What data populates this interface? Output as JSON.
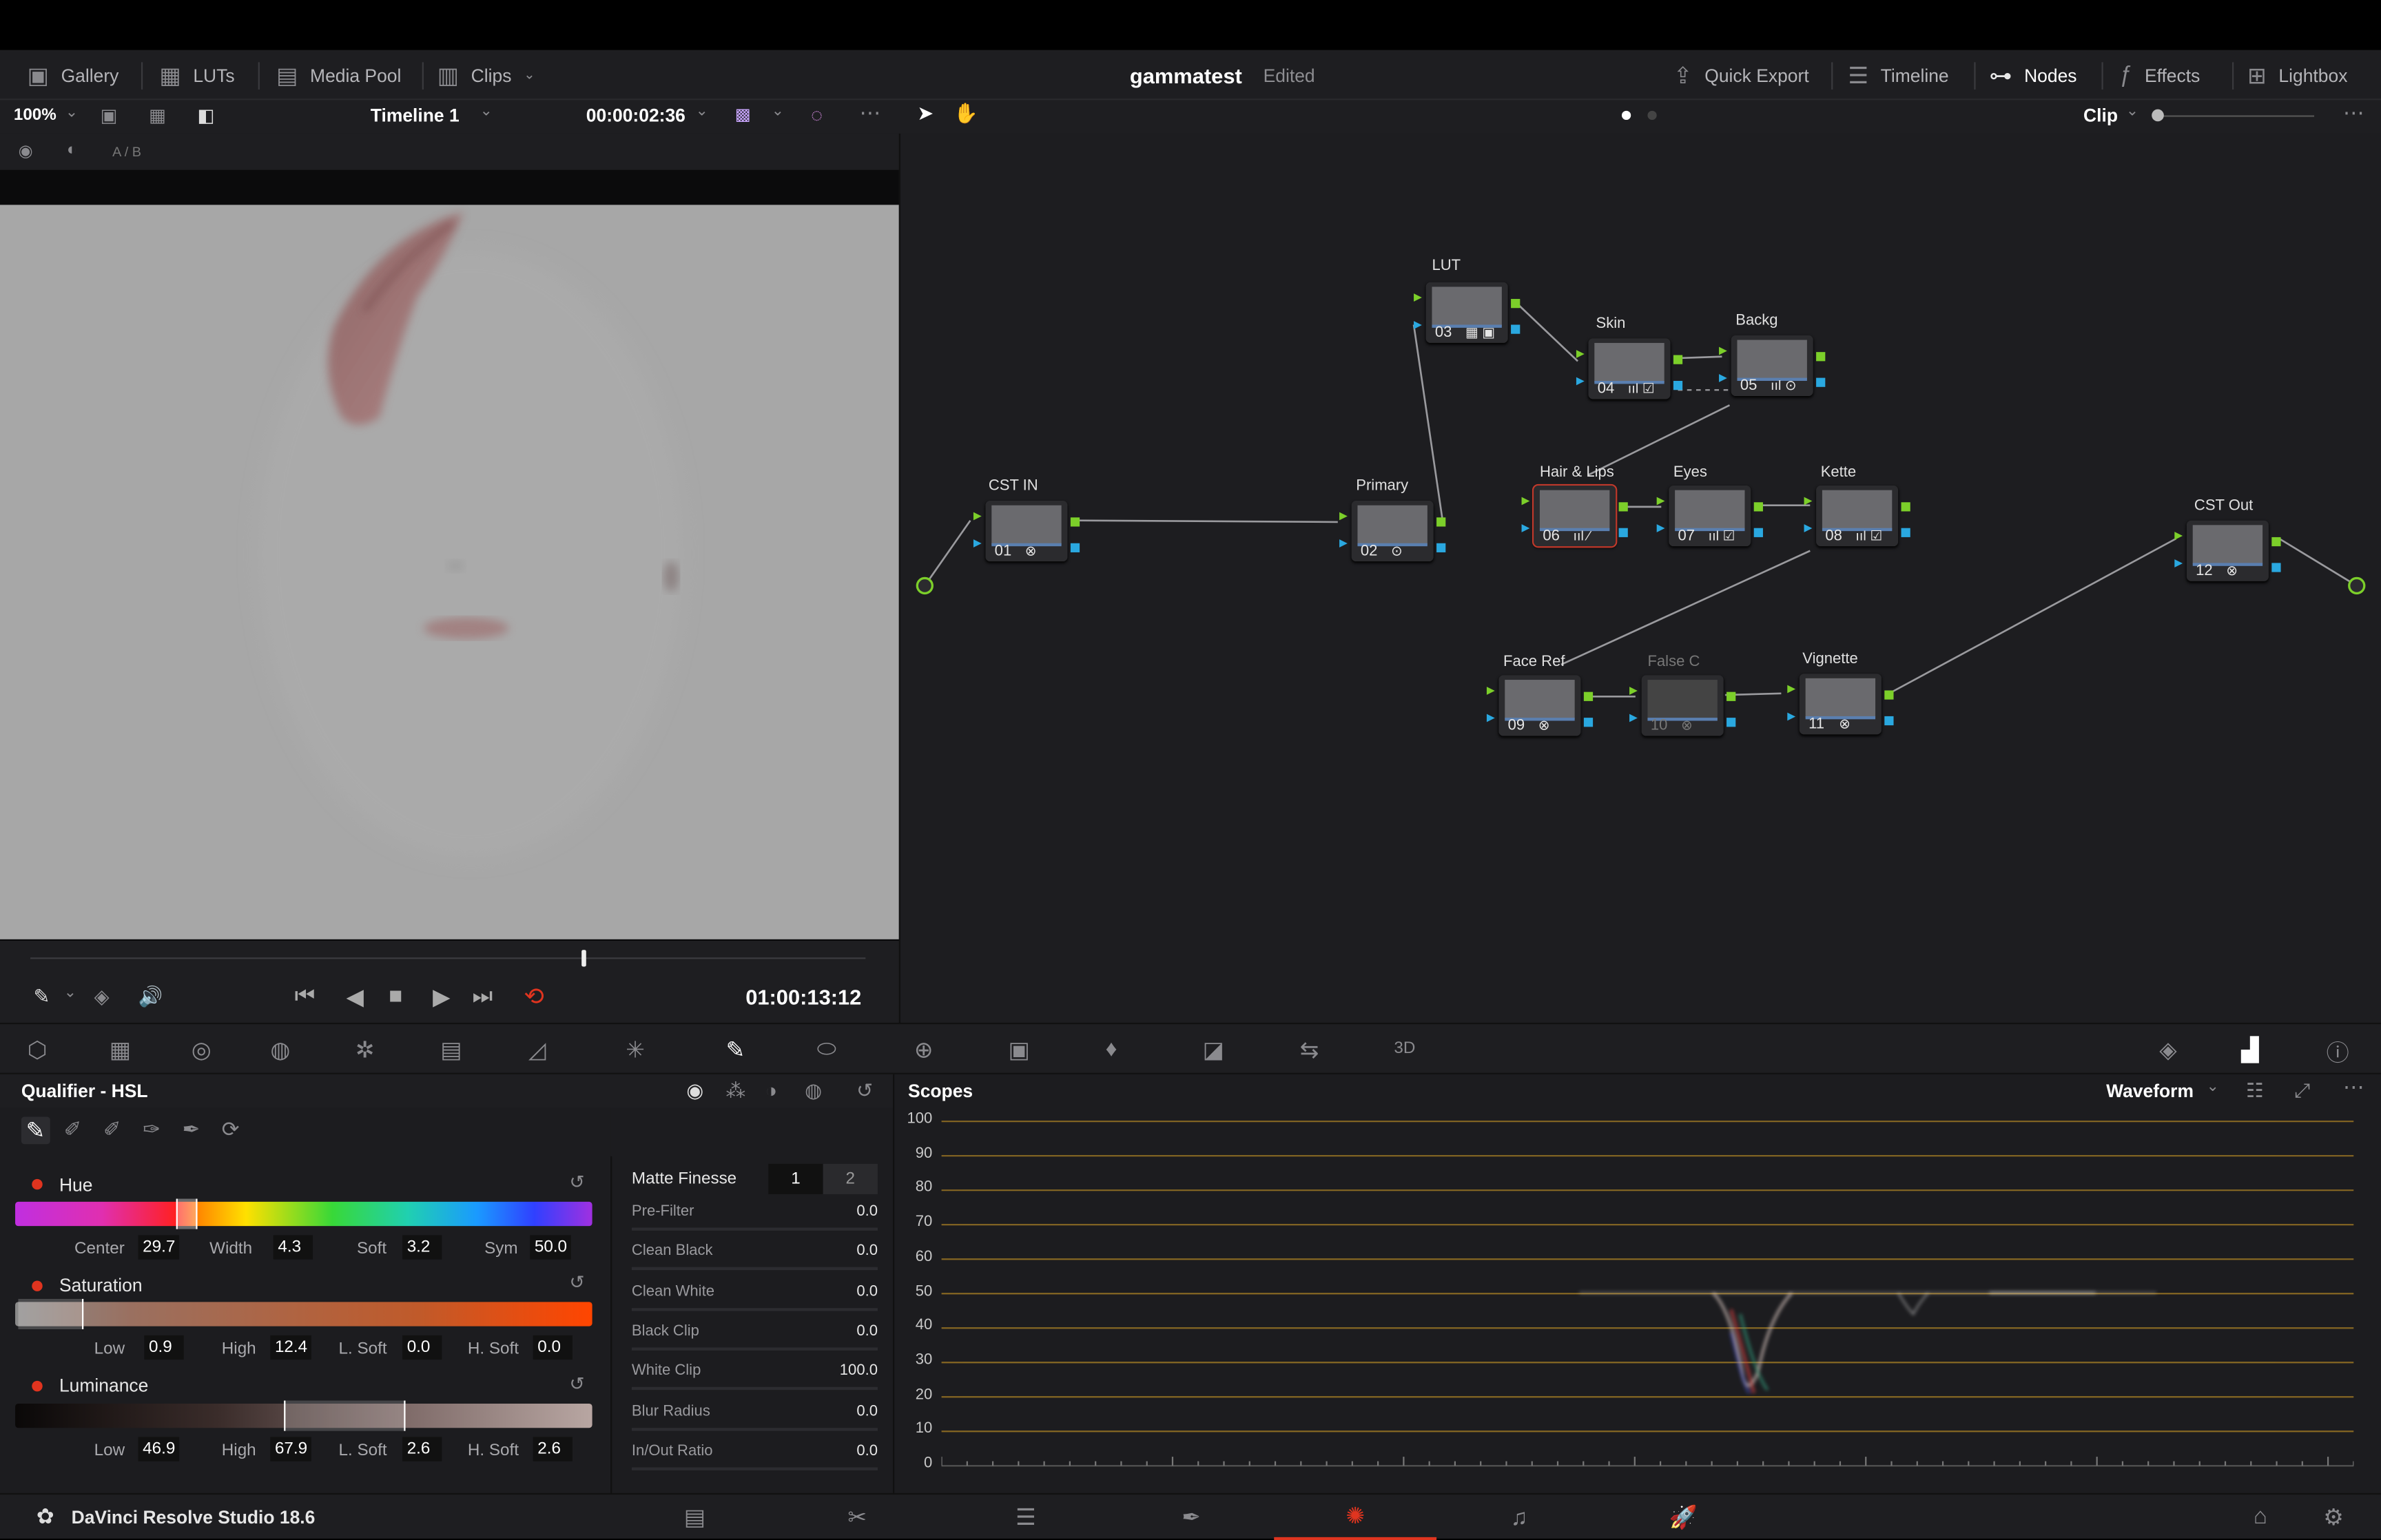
{
  "header": {
    "menu_left": [
      {
        "label": "Gallery",
        "icon": "gallery-icon"
      },
      {
        "label": "LUTs",
        "icon": "luts-icon"
      },
      {
        "label": "Media Pool",
        "icon": "media-pool-icon"
      },
      {
        "label": "Clips",
        "icon": "clips-icon"
      }
    ],
    "project_title": "gammatest",
    "project_status": "Edited",
    "menu_right": [
      {
        "label": "Quick Export",
        "icon": "export-icon"
      },
      {
        "label": "Timeline",
        "icon": "timeline-icon"
      },
      {
        "label": "Nodes",
        "icon": "nodes-icon"
      },
      {
        "label": "Effects",
        "icon": "fx-icon"
      },
      {
        "label": "Lightbox",
        "icon": "lightbox-icon"
      }
    ]
  },
  "viewer": {
    "zoom": "100%",
    "timeline_name": "Timeline 1",
    "source_timecode": "00:00:02:36",
    "ab_label": "A / B",
    "playhead_timecode": "01:00:13:12",
    "scrub_position": 0.66
  },
  "node_editor": {
    "mode": "Clip",
    "nodes": [
      {
        "label": "CST IN",
        "num": "01",
        "icon": "⊗"
      },
      {
        "label": "Primary",
        "num": "02",
        "icon": "⊙"
      },
      {
        "label": "LUT",
        "num": "03",
        "icon": "▦ ▣"
      },
      {
        "label": "Skin",
        "num": "04",
        "icon": "ııl ☑"
      },
      {
        "label": "Backg",
        "num": "05",
        "icon": "ııl ⊙"
      },
      {
        "label": "Hair & Lips",
        "num": "06",
        "icon": "ııl ⁄"
      },
      {
        "label": "Eyes",
        "num": "07",
        "icon": "ııl ☑"
      },
      {
        "label": "Kette",
        "num": "08",
        "icon": "ııl ☑"
      },
      {
        "label": "Face Ref",
        "num": "09",
        "icon": "⊗"
      },
      {
        "label": "False C",
        "num": "10",
        "icon": "⊗"
      },
      {
        "label": "Vignette",
        "num": "11",
        "icon": "⊗"
      },
      {
        "label": "CST Out",
        "num": "12",
        "icon": "⊗"
      }
    ]
  },
  "qualifier": {
    "title": "Qualifier - HSL",
    "hue": {
      "label": "Hue",
      "center_label": "Center",
      "center": "29.7",
      "width_label": "Width",
      "width": "4.3",
      "soft_label": "Soft",
      "soft": "3.2",
      "sym_label": "Sym",
      "sym": "50.0"
    },
    "saturation": {
      "label": "Saturation",
      "low_label": "Low",
      "low": "0.9",
      "high_label": "High",
      "high": "12.4",
      "lsoft_label": "L. Soft",
      "lsoft": "0.0",
      "hsoft_label": "H. Soft",
      "hsoft": "0.0"
    },
    "luminance": {
      "label": "Luminance",
      "low_label": "Low",
      "low": "46.9",
      "high_label": "High",
      "high": "67.9",
      "lsoft_label": "L. Soft",
      "lsoft": "2.6",
      "hsoft_label": "H. Soft",
      "hsoft": "2.6"
    }
  },
  "matte_finesse": {
    "title": "Matte Finesse",
    "tab1": "1",
    "tab2": "2",
    "rows": [
      {
        "label": "Pre-Filter",
        "value": "0.0"
      },
      {
        "label": "Clean Black",
        "value": "0.0"
      },
      {
        "label": "Clean White",
        "value": "0.0"
      },
      {
        "label": "Black Clip",
        "value": "0.0"
      },
      {
        "label": "White Clip",
        "value": "100.0"
      },
      {
        "label": "Blur Radius",
        "value": "0.0"
      },
      {
        "label": "In/Out Ratio",
        "value": "0.0"
      }
    ]
  },
  "scopes": {
    "title": "Scopes",
    "mode": "Waveform",
    "scale": [
      "100",
      "90",
      "80",
      "70",
      "60",
      "50",
      "40",
      "30",
      "20",
      "10",
      "0"
    ]
  },
  "footer": {
    "app_name": "DaVinci Resolve Studio 18.6",
    "pages": [
      "media-page-icon",
      "cut-page-icon",
      "edit-page-icon",
      "fusion-page-icon",
      "color-page-icon",
      "fairlight-page-icon",
      "deliver-page-icon"
    ],
    "active_page": "color-page-icon"
  },
  "colors": {
    "accent_red": "#e0341f",
    "node_green": "#7ccf2a",
    "node_blue": "#2aa8e0",
    "scope_line": "#a07a24"
  }
}
